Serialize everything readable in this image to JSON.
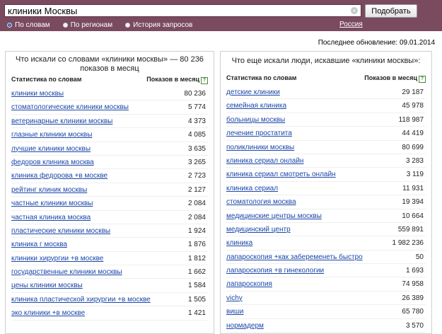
{
  "search": {
    "query": "клиники Москвы",
    "clear_glyph": "×",
    "submit_label": "Подобрать"
  },
  "modes": [
    {
      "label": "По словам",
      "selected": true
    },
    {
      "label": "По регионам",
      "selected": false
    },
    {
      "label": "История запросов",
      "selected": false
    }
  ],
  "region": "Россия",
  "updated": "Последнее обновление: 09.01.2014",
  "left_panel": {
    "title": "Что искали со словами «клиники москвы» — 80 236 показов в месяц",
    "col_query": "Статистика по словам",
    "col_count": "Показов в месяц",
    "help": "?",
    "rows": [
      {
        "q": "клиники москвы",
        "n": "80 236"
      },
      {
        "q": "стоматологические клиники москвы",
        "n": "5 774"
      },
      {
        "q": "ветеринарные клиники москвы",
        "n": "4 373"
      },
      {
        "q": "глазные клиники москвы",
        "n": "4 085"
      },
      {
        "q": "лучшие клиники москвы",
        "n": "3 635"
      },
      {
        "q": "федоров клиника москва",
        "n": "3 265"
      },
      {
        "q": "клиника федорова +в москве",
        "n": "2 723"
      },
      {
        "q": "рейтинг клиник москвы",
        "n": "2 127"
      },
      {
        "q": "частные клиники москвы",
        "n": "2 084"
      },
      {
        "q": "частная клиника москва",
        "n": "2 084"
      },
      {
        "q": "пластические клиники москвы",
        "n": "1 924"
      },
      {
        "q": "клиника г москва",
        "n": "1 876"
      },
      {
        "q": "клиники хирургии +в москве",
        "n": "1 812"
      },
      {
        "q": "государственные клиники москвы",
        "n": "1 662"
      },
      {
        "q": "цены клиники москвы",
        "n": "1 584"
      },
      {
        "q": "клиника пластической хирургии +в москве",
        "n": "1 505"
      },
      {
        "q": "эко клиники +в москве",
        "n": "1 421"
      }
    ]
  },
  "right_panel": {
    "title": "Что еще искали люди, искавшие «клиники москвы»:",
    "col_query": "Статистика по словам",
    "col_count": "Показов в месяц",
    "help": "?",
    "rows": [
      {
        "q": "детские клиники",
        "n": "29 187"
      },
      {
        "q": "семейная клиника",
        "n": "45 978"
      },
      {
        "q": "больницы москвы",
        "n": "118 987"
      },
      {
        "q": "лечение простатита",
        "n": "44 419"
      },
      {
        "q": "поликлиники москвы",
        "n": "80 699"
      },
      {
        "q": "клиника сериал онлайн",
        "n": "3 283"
      },
      {
        "q": "клиника сериал смотреть онлайн",
        "n": "3 119"
      },
      {
        "q": "клиника сериал",
        "n": "11 931"
      },
      {
        "q": "стоматология москва",
        "n": "19 394"
      },
      {
        "q": "медицинские центры москвы",
        "n": "10 664"
      },
      {
        "q": "медицинский центр",
        "n": "559 891"
      },
      {
        "q": "клиника",
        "n": "1 982 236"
      },
      {
        "q": "лапароскопия +как забеременеть быстро",
        "n": "50"
      },
      {
        "q": "лапароскопия +в гинекологии",
        "n": "1 693"
      },
      {
        "q": "лапароскопия",
        "n": "74 958"
      },
      {
        "q": "vichy",
        "n": "26 389"
      },
      {
        "q": "виши",
        "n": "65 780"
      },
      {
        "q": "нормадерм",
        "n": "3 570"
      }
    ]
  }
}
